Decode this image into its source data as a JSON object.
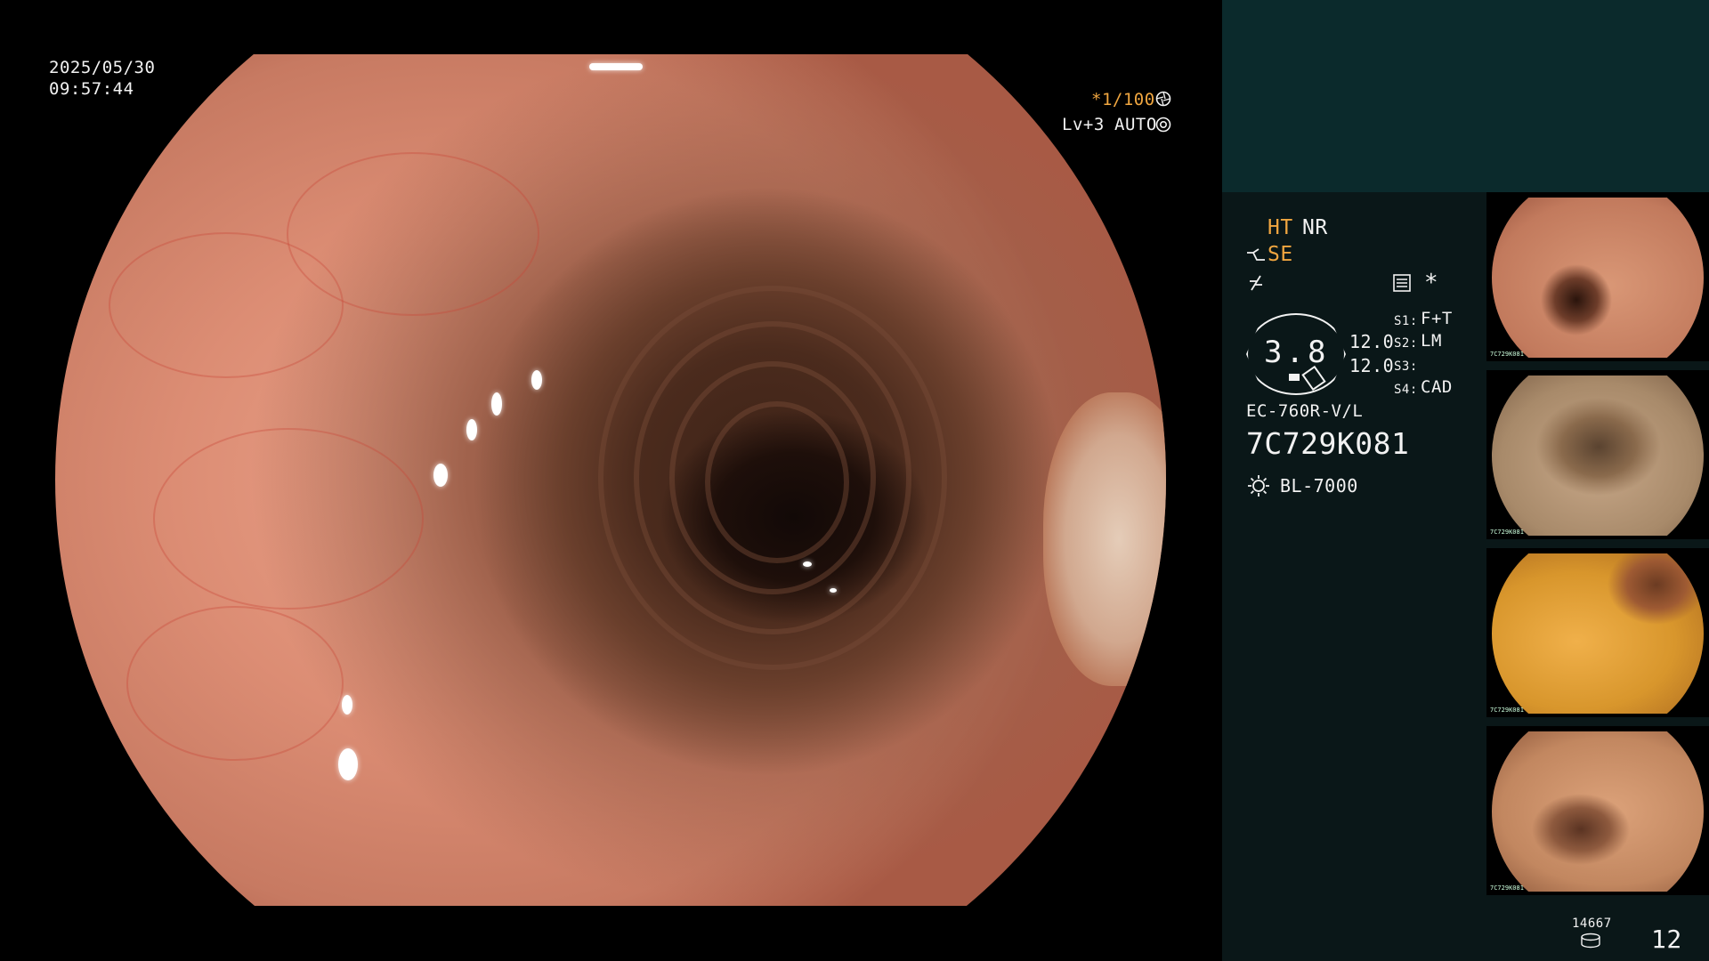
{
  "datetime": {
    "date": "2025/05/30",
    "time": "09:57:44"
  },
  "scope_settings": {
    "shutter": "*1/100",
    "shutter_icon": "aperture-icon",
    "level": "Lv+3",
    "mode": "AUTO",
    "mode_icon": "gear-icon"
  },
  "panel": {
    "ht": "HT",
    "nr": "NR",
    "se": "SE",
    "magnification": "3.8",
    "values": [
      "12.0",
      "12.0"
    ],
    "switches": [
      {
        "key": "S1:",
        "value": "F+T"
      },
      {
        "key": "S2:",
        "value": "LM"
      },
      {
        "key": "S3:",
        "value": ""
      },
      {
        "key": "S4:",
        "value": "CAD"
      }
    ],
    "asterisk": "*",
    "scope_model": "EC-760R-V/L",
    "serial": "7C729K081",
    "light_source": "BL-7000",
    "storage_count": "14667",
    "image_count": "12",
    "icons": {
      "instrument": "forceps-icon",
      "filter": "filter-icon",
      "memo": "memo-icon",
      "light": "sun-icon",
      "storage": "disk-icon"
    }
  },
  "thumbnails": [
    {
      "id": "thumb-1",
      "serial": "7C729K081",
      "tint": "#c98a6c"
    },
    {
      "id": "thumb-2",
      "serial": "7C729K081",
      "tint": "#a88a6a"
    },
    {
      "id": "thumb-3",
      "serial": "7C729K081",
      "tint": "#d8962c"
    },
    {
      "id": "thumb-4",
      "serial": "7C729K081",
      "tint": "#c28760"
    }
  ],
  "colors": {
    "accent": "#f0a640",
    "text": "#f2f2f2",
    "panel_top": "#0b2a2c",
    "panel_body": "#0a1718"
  }
}
